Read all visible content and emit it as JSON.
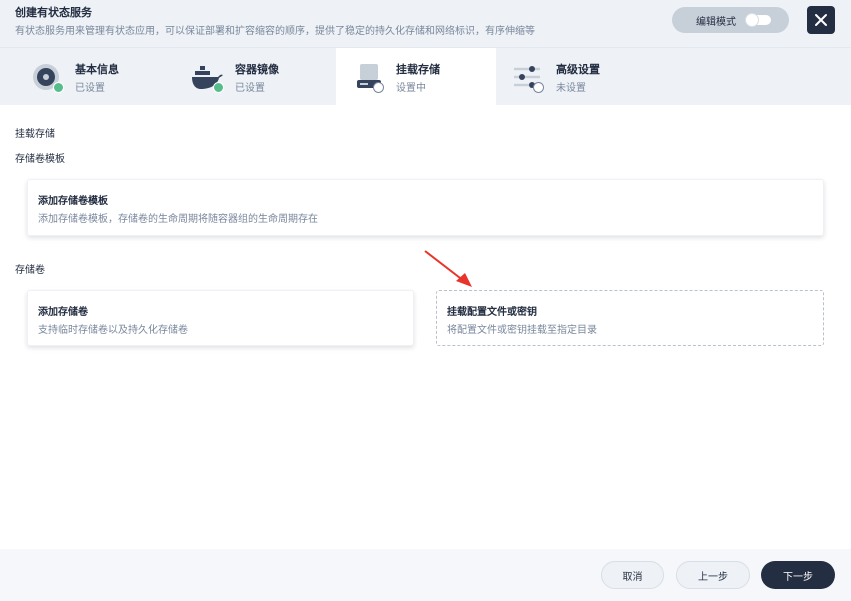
{
  "header": {
    "title": "创建有状态服务",
    "subtitle": "有状态服务用来管理有状态应用，可以保证部署和扩容缩容的顺序，提供了稳定的持久化存储和网络标识，有序伸缩等",
    "edit_mode_label": "编辑模式",
    "close_icon": "close-icon"
  },
  "tabs": [
    {
      "label": "基本信息",
      "status": "已设置",
      "icon": "disk-icon",
      "state": "done"
    },
    {
      "label": "容器镜像",
      "status": "已设置",
      "icon": "docker-icon",
      "state": "done"
    },
    {
      "label": "挂载存储",
      "status": "设置中",
      "icon": "storage-icon",
      "state": "active"
    },
    {
      "label": "高级设置",
      "status": "未设置",
      "icon": "sliders-icon",
      "state": "todo"
    }
  ],
  "main": {
    "heading": "挂载存储",
    "template_section": {
      "title": "存储卷模板",
      "card": {
        "title": "添加存储卷模板",
        "desc": "添加存储卷模板，存储卷的生命周期将随容器组的生命周期存在"
      }
    },
    "volume_section": {
      "title": "存储卷",
      "cards": [
        {
          "title": "添加存储卷",
          "desc": "支持临时存储卷以及持久化存储卷"
        },
        {
          "title": "挂载配置文件或密钥",
          "desc": "将配置文件或密钥挂载至指定目录"
        }
      ]
    }
  },
  "footer": {
    "cancel_label": "取消",
    "prev_label": "上一步",
    "next_label": "下一步"
  },
  "colors": {
    "accent_dark": "#242e42",
    "success": "#55bc8a",
    "annotation_arrow": "#e8342b"
  }
}
